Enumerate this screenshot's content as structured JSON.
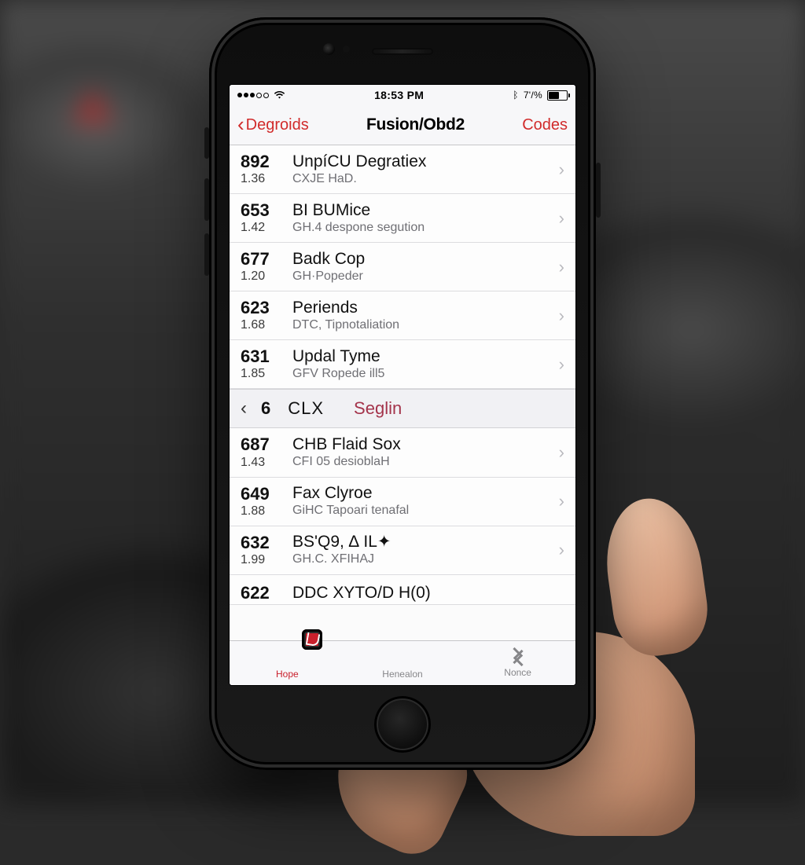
{
  "status": {
    "carrier_dots": 5,
    "time": "18:53 PM",
    "battery_text": "7'/%",
    "wifi": true
  },
  "nav": {
    "back_label": "Degroids",
    "title": "Fusion/Obd2",
    "action_label": "Codes"
  },
  "section": {
    "prev_glyph": "‹",
    "num": "6",
    "code": "CLX",
    "label": "Seglin"
  },
  "rows_top": [
    {
      "code": "892",
      "sub": "1.36",
      "title": "UnpíCU Degratiex",
      "desc": "CXJE HaD."
    },
    {
      "code": "653",
      "sub": "1.42",
      "title": "BI BUMice",
      "desc": "GH.4 despone segution"
    },
    {
      "code": "677",
      "sub": "1.20",
      "title": "Badk Cop",
      "desc": "GH·Popeder"
    },
    {
      "code": "623",
      "sub": "1.68",
      "title": "Periends",
      "desc": "DTC, Tipnotaliation"
    },
    {
      "code": "631",
      "sub": "1.85",
      "title": "Updal Tyme",
      "desc": "GFV Ropede ill5"
    }
  ],
  "rows_bottom": [
    {
      "code": "687",
      "sub": "1.43",
      "title": "CHB Flaid Sox",
      "desc": "CFI 05 desioblaH"
    },
    {
      "code": "649",
      "sub": "1.88",
      "title": "Fax Clyroe",
      "desc": "GiHC Tapoari tenafal"
    },
    {
      "code": "632",
      "sub": "1.99",
      "title": "BS'Q9, ∆ IL✦",
      "desc": "GH.C. XFIHAJ"
    },
    {
      "code": "622",
      "sub": "",
      "title": "DDC  XYTO/D H(0)",
      "desc": ""
    }
  ],
  "tabs": {
    "home": "Hope",
    "middle": "Henealon",
    "right": "Nonce"
  },
  "icons": {
    "back_chevron": "‹",
    "disclosure": "›"
  }
}
